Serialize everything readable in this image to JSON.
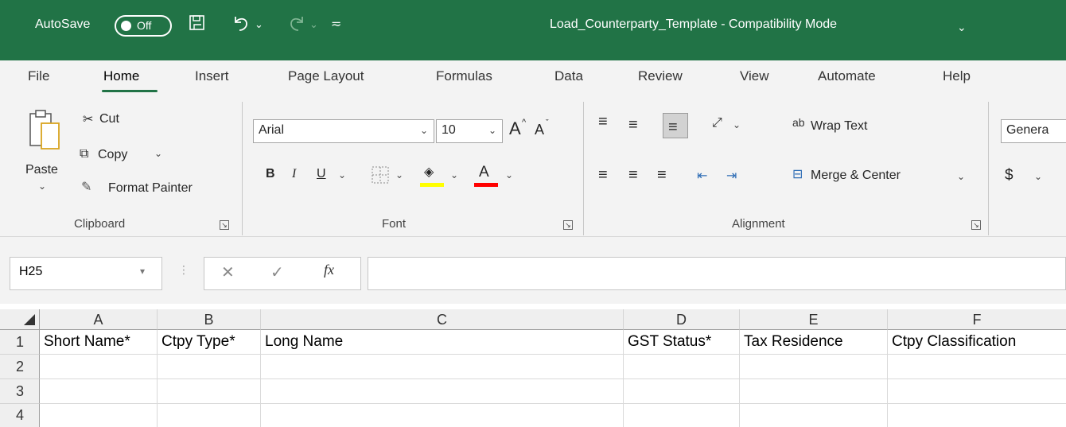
{
  "titlebar": {
    "autosave_label": "AutoSave",
    "autosave_state": "Off",
    "document_title": "Load_Counterparty_Template  -  Compatibility Mode",
    "icons": [
      "save-icon",
      "undo-icon",
      "redo-icon",
      "customize-qat-icon"
    ]
  },
  "tabs": [
    "File",
    "Home",
    "Insert",
    "Page Layout",
    "Formulas",
    "Data",
    "Review",
    "View",
    "Automate",
    "Help"
  ],
  "active_tab": "Home",
  "ribbon": {
    "clipboard": {
      "group_label": "Clipboard",
      "paste": "Paste",
      "cut": "Cut",
      "copy": "Copy",
      "format_painter": "Format Painter"
    },
    "font": {
      "group_label": "Font",
      "font_name": "Arial",
      "font_size": "10",
      "bold": "B",
      "italic": "I",
      "underline": "U",
      "grow": "A",
      "shrink": "A",
      "font_color_letter": "A",
      "highlight_color": "#ffff00",
      "font_color": "#ff0000"
    },
    "alignment": {
      "group_label": "Alignment",
      "wrap_text": "Wrap Text",
      "merge_center": "Merge & Center",
      "wrap_glyph": "ab"
    },
    "number": {
      "format": "Genera",
      "currency": "$"
    }
  },
  "formula_bar": {
    "name_box": "H25",
    "formula": "",
    "fx_label": "fx"
  },
  "grid": {
    "columns": [
      "A",
      "B",
      "C",
      "D",
      "E",
      "F"
    ],
    "rows": [
      "1",
      "2",
      "3",
      "4"
    ],
    "row1": [
      "Short Name*",
      "Ctpy Type*",
      "Long Name",
      "GST Status*",
      "Tax Residence",
      "Ctpy Classification"
    ]
  },
  "colors": {
    "excel_green": "#217346",
    "ribbon_bg": "#f3f3f3"
  }
}
